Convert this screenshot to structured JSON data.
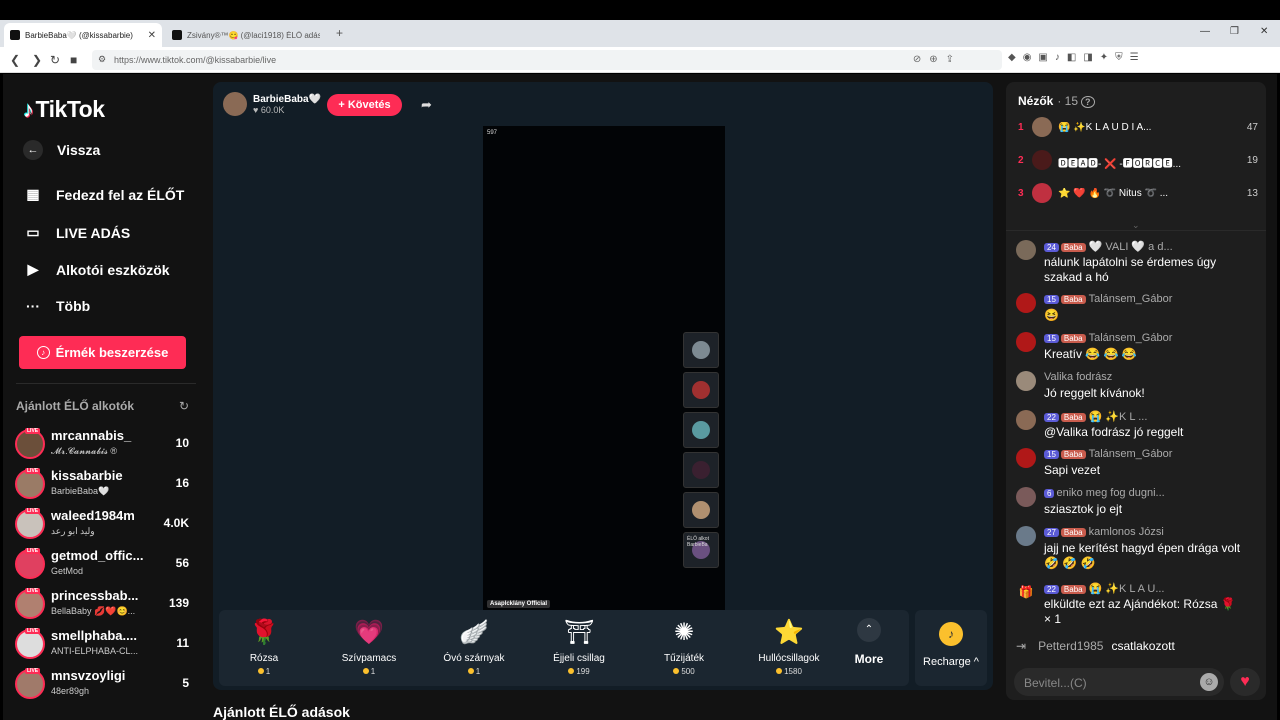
{
  "browser": {
    "tabs": [
      {
        "title": "BarbieBaba🤍 (@kissabarbie)",
        "close": "✕"
      },
      {
        "title": "Zsivány®™😋 (@laci1918) ÉLŐ adás",
        "close": ""
      }
    ],
    "new_tab": "+",
    "url": "https://www.tiktok.com/@kissabarbie/live"
  },
  "sidebar": {
    "logo": "TikTok",
    "back": "Vissza",
    "nav": [
      {
        "label": "Fedezd fel az ÉLŐT",
        "icon": "calendar-icon"
      },
      {
        "label": "LIVE ADÁS",
        "icon": "video-icon"
      },
      {
        "label": "Alkotói eszközök",
        "icon": "creator-tools-icon"
      },
      {
        "label": "Több",
        "icon": "more-icon"
      }
    ],
    "coin_button": "Érmék beszerzése",
    "recommended_title": "Ajánlott ÉLŐ alkotók",
    "creators": [
      {
        "name": "mrcannabis_",
        "sub": "𝓜𝓻.𝓒𝓪𝓷𝓷𝓪𝓫𝓲𝓼 ®",
        "count": "10"
      },
      {
        "name": "kissabarbie",
        "sub": "BarbieBaba🤍",
        "count": "16"
      },
      {
        "name": "waleed1984m",
        "sub": "وليد ابو رعد",
        "count": "4.0K"
      },
      {
        "name": "getmod_offic...",
        "sub": "GetMod",
        "count": "56"
      },
      {
        "name": "princessbab...",
        "sub": "BellaBaby 💋❤️😊...",
        "count": "139"
      },
      {
        "name": "smellphaba....",
        "sub": "ANTI-ELPHABA-CL...",
        "count": "11"
      },
      {
        "name": "mnsvzoyligi",
        "sub": "48er89gh",
        "count": "5"
      }
    ],
    "live_tag": "LIVE"
  },
  "stream": {
    "host_name": "BarbieBaba🤍",
    "host_likes": "♥ 60.0K",
    "follow": "+ Követés",
    "viewer_count": "597",
    "bottom_tag": "Asaplcklány Official",
    "guests": [
      "",
      "",
      "",
      "",
      "",
      "ÉLŐ alkot BarbieBa"
    ],
    "gifts": [
      {
        "name": "Rózsa",
        "price": "1",
        "icon": "🌹"
      },
      {
        "name": "Szívpamacs",
        "price": "1",
        "icon": "💗"
      },
      {
        "name": "Óvó szárnyak",
        "price": "1",
        "icon": "🪽"
      },
      {
        "name": "Éjjeli csillag",
        "price": "199",
        "icon": "⛩"
      },
      {
        "name": "Tűzijáték",
        "price": "500",
        "icon": "✺"
      },
      {
        "name": "Hullócsillagok",
        "price": "1580",
        "icon": "⭐"
      }
    ],
    "more": "More",
    "recharge": "Recharge ^",
    "recommended_live": "Ajánlott ÉLŐ adások"
  },
  "viewers": {
    "title": "Nézők",
    "count": "· 15",
    "top": [
      {
        "rank": "1",
        "name": "😭 ✨K L A U D I A...",
        "score": "47"
      },
      {
        "rank": "2",
        "name": "🅳🅴🅰🅳- ❌ -🅵🅾🆁🅲🅴...",
        "score": "19"
      },
      {
        "rank": "3",
        "name": "⭐ ❤️ 🔥 ➰ Nitus ➰ ...",
        "score": "13"
      }
    ]
  },
  "chat": [
    {
      "lvl": "24",
      "fan": "Baba",
      "user": "🤍 VALI 🤍 a d...",
      "text": "nálunk lapátolni se érdemes úgy szakad a hó"
    },
    {
      "lvl": "15",
      "fan": "Baba",
      "user": "Talánsem_Gábor",
      "text": "😆"
    },
    {
      "lvl": "15",
      "fan": "Baba",
      "user": "Talánsem_Gábor",
      "text": "Kreatív 😂 😂 😂"
    },
    {
      "lvl": "",
      "fan": "",
      "user": "Valika fodrász",
      "text": "Jó reggelt kívánok!"
    },
    {
      "lvl": "22",
      "fan": "Baba",
      "user": "😭 ✨K L ...",
      "text": "@Valika fodrász jó reggelt"
    },
    {
      "lvl": "15",
      "fan": "Baba",
      "user": "Talánsem_Gábor",
      "text": "Sapi vezet"
    },
    {
      "lvl": "6",
      "fan": "",
      "user": "eniko meg fog dugni...",
      "text": "sziasztok jo ejt"
    },
    {
      "lvl": "27",
      "fan": "Baba",
      "user": "kamlonos Józsi",
      "text": "jajj ne kerítést hagyd épen drága volt🤣 🤣 🤣"
    },
    {
      "lvl": "22",
      "fan": "Baba",
      "user": "😭 ✨K L A U...",
      "text": "elküldte ezt az Ajándékot: Rózsa 🌹 × 1"
    }
  ],
  "joined": {
    "user": "Petterd1985",
    "text": "csatlakozott"
  },
  "input_placeholder": "Bevitel...(C)"
}
